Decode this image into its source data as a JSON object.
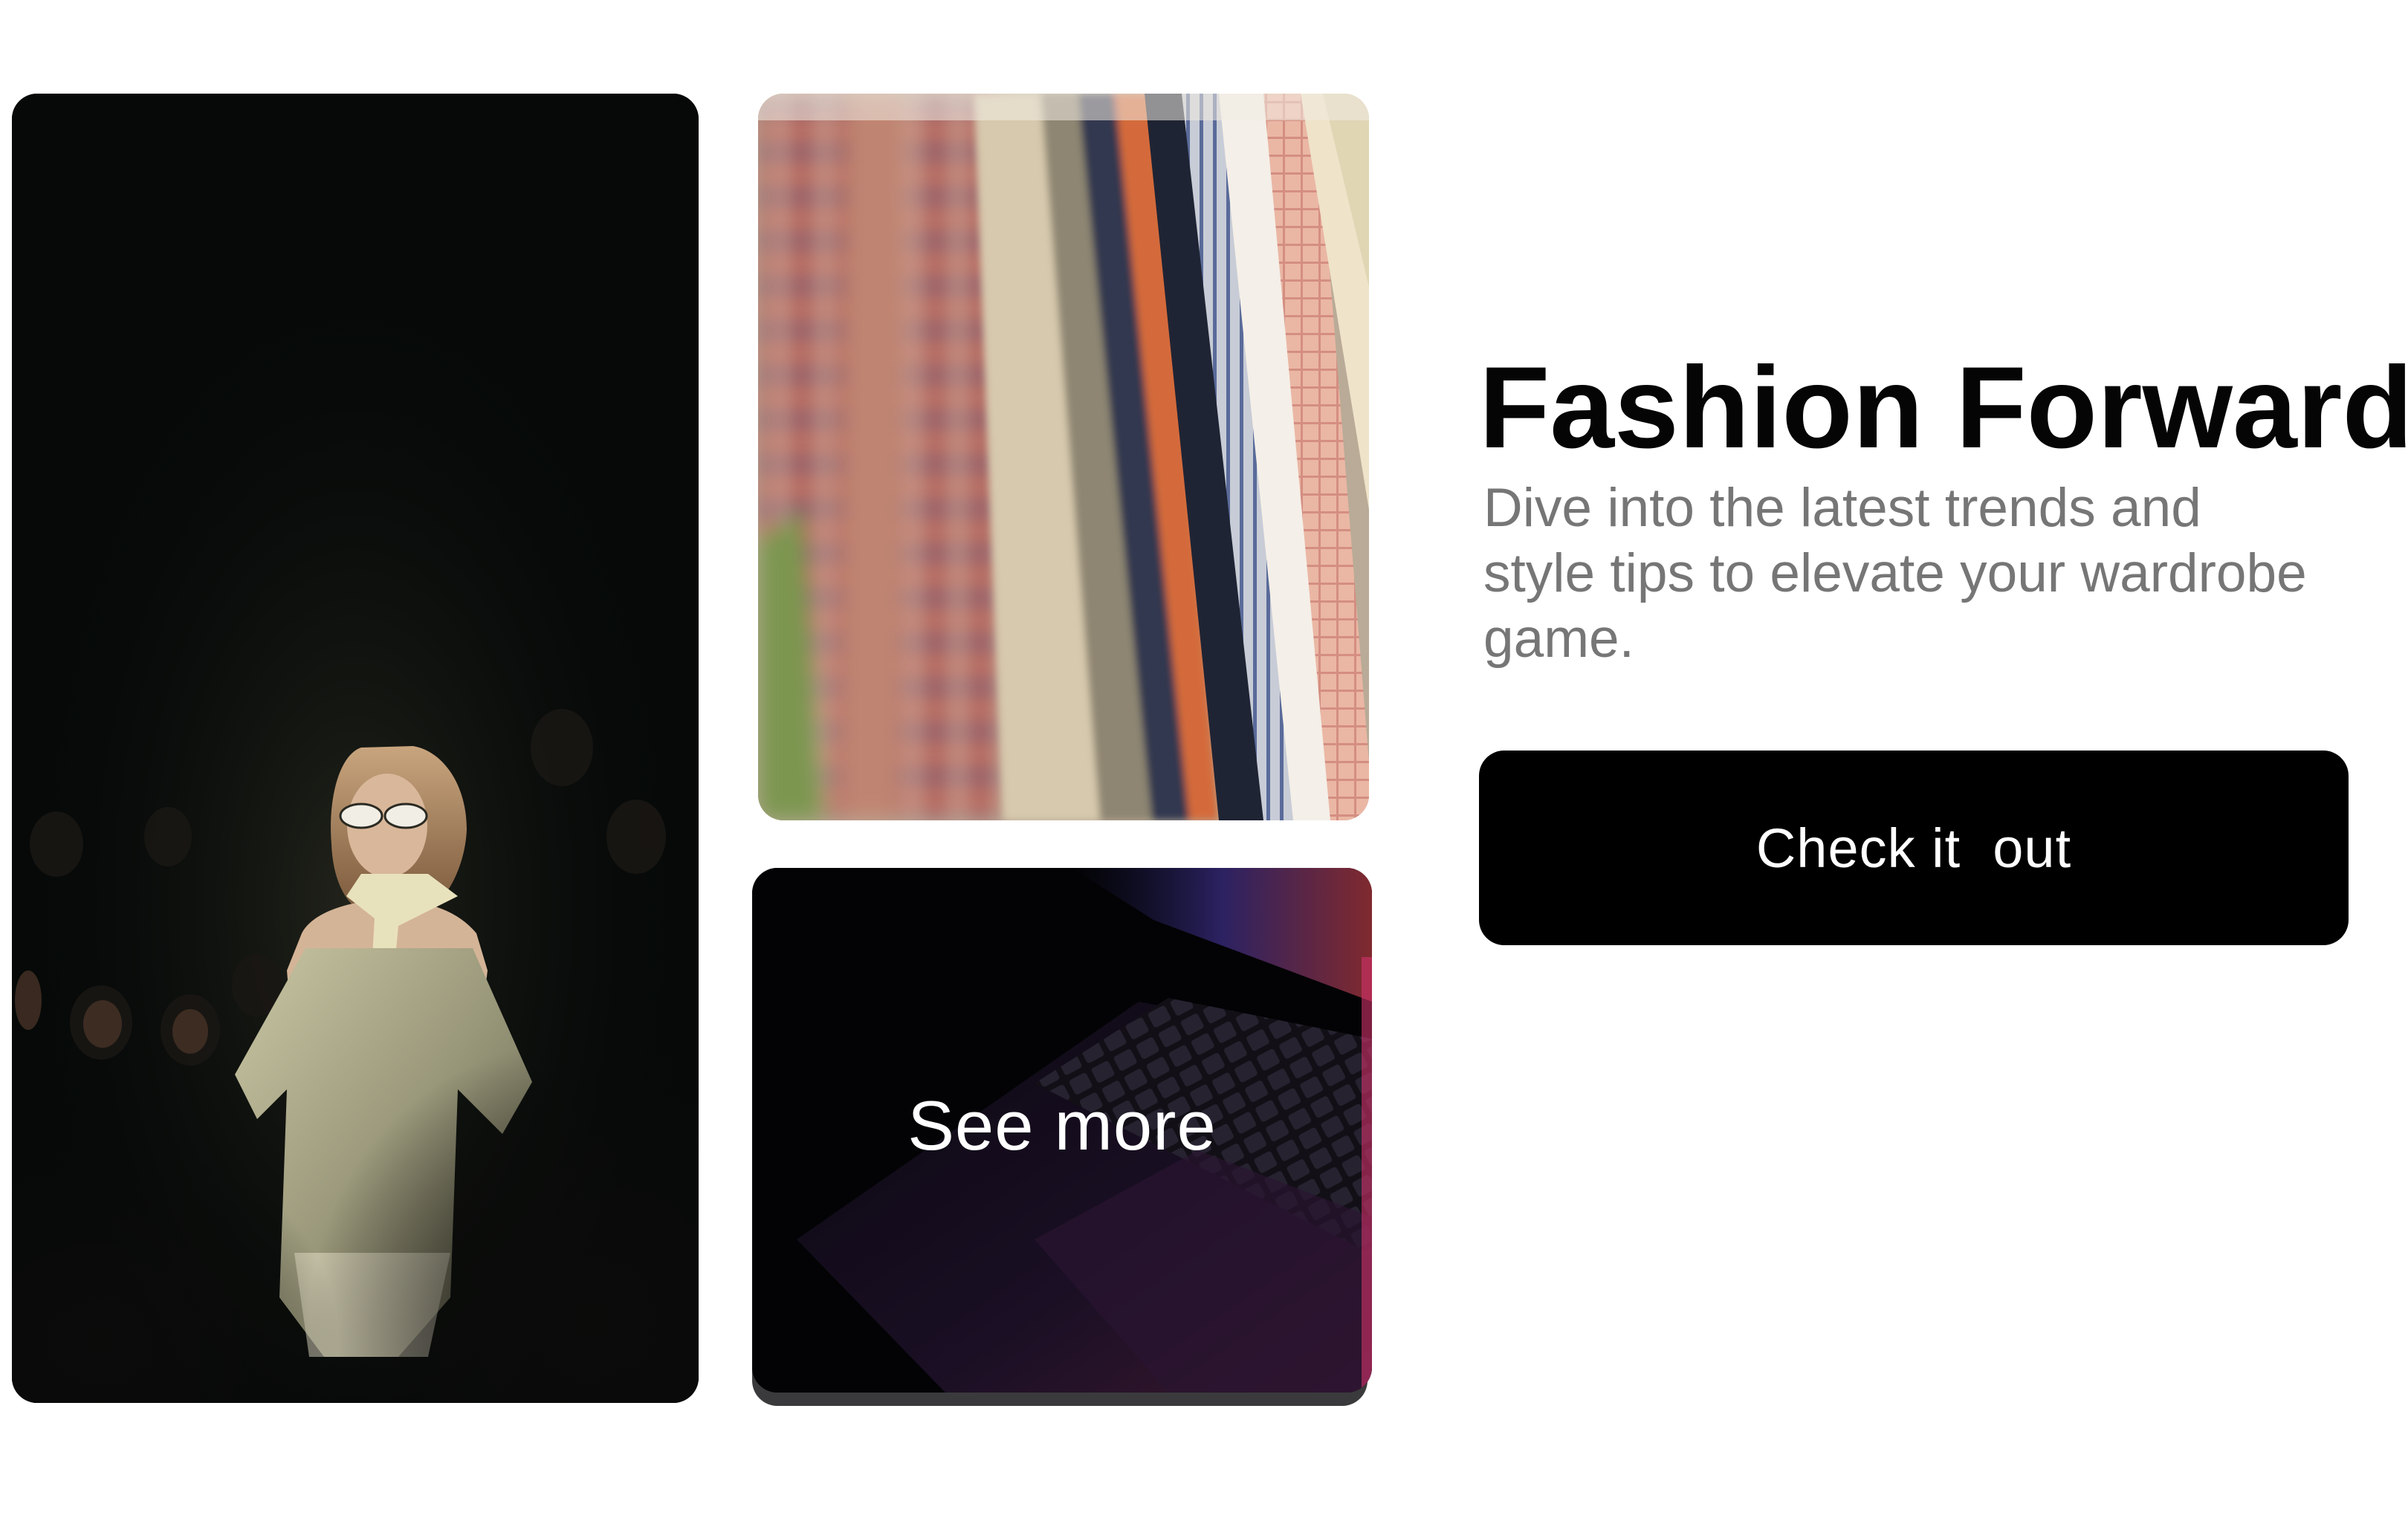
{
  "hero": {
    "title": "Fashion Forward",
    "subtitle": "Dive into the latest trends and style tips to elevate your wardrobe game.",
    "cta_label": "Check it  out"
  },
  "gallery": {
    "see_more_label": "See more"
  },
  "colors": {
    "background": "#ffffff",
    "button": "#000000",
    "button_text": "#ffffff",
    "title": "#050505",
    "subtitle": "#767676"
  }
}
